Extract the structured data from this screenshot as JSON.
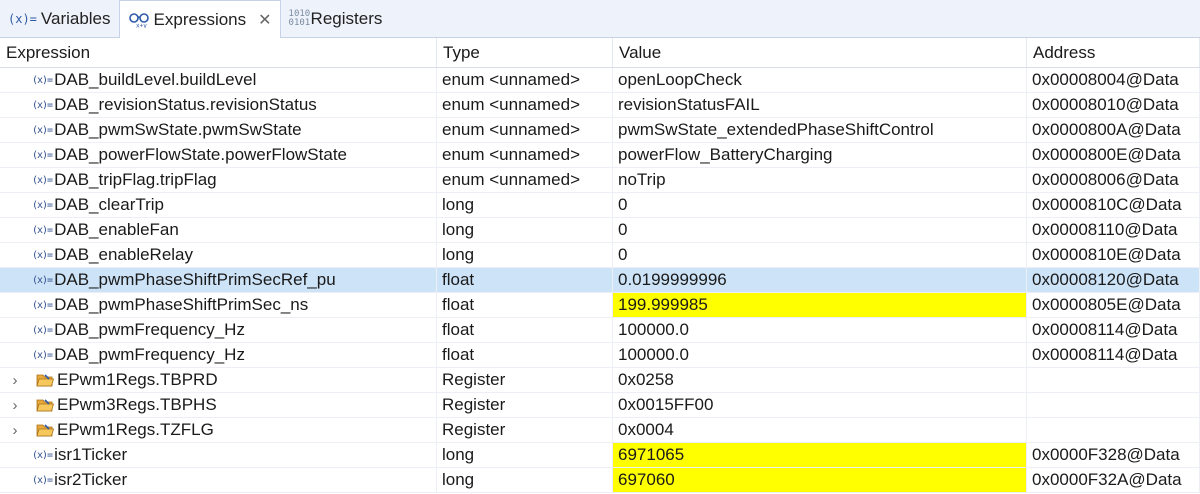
{
  "tabs": [
    {
      "label": "Variables",
      "icon": "variables-icon"
    },
    {
      "label": "Expressions",
      "icon": "expressions-icon",
      "active": true
    },
    {
      "label": "Registers",
      "icon": "registers-icon"
    }
  ],
  "tab_icons": {
    "variables": "(x)=",
    "registers_top": "1010",
    "registers_bottom": "0101",
    "close": "✕"
  },
  "columns": [
    "Expression",
    "Type",
    "Value",
    "Address"
  ],
  "rows": [
    {
      "expr": "DAB_buildLevel.buildLevel",
      "type": "enum <unnamed>",
      "value": "openLoopCheck",
      "addr": "0x00008004@Data"
    },
    {
      "expr": "DAB_revisionStatus.revisionStatus",
      "type": "enum <unnamed>",
      "value": "revisionStatusFAIL",
      "addr": "0x00008010@Data"
    },
    {
      "expr": "DAB_pwmSwState.pwmSwState",
      "type": "enum <unnamed>",
      "value": "pwmSwState_extendedPhaseShiftControl",
      "addr": "0x0000800A@Data"
    },
    {
      "expr": "DAB_powerFlowState.powerFlowState",
      "type": "enum <unnamed>",
      "value": "powerFlow_BatteryCharging",
      "addr": "0x0000800E@Data"
    },
    {
      "expr": "DAB_tripFlag.tripFlag",
      "type": "enum <unnamed>",
      "value": "noTrip",
      "addr": "0x00008006@Data"
    },
    {
      "expr": "DAB_clearTrip",
      "type": "long",
      "value": "0",
      "addr": "0x0000810C@Data"
    },
    {
      "expr": "DAB_enableFan",
      "type": "long",
      "value": "0",
      "addr": "0x00008110@Data"
    },
    {
      "expr": "DAB_enableRelay",
      "type": "long",
      "value": "0",
      "addr": "0x0000810E@Data"
    },
    {
      "expr": "DAB_pwmPhaseShiftPrimSecRef_pu",
      "type": "float",
      "value": "0.0199999996",
      "addr": "0x00008120@Data",
      "selected": true
    },
    {
      "expr": "DAB_pwmPhaseShiftPrimSec_ns",
      "type": "float",
      "value": "199.999985",
      "addr": "0x0000805E@Data",
      "highlight": true
    },
    {
      "expr": "DAB_pwmFrequency_Hz",
      "type": "float",
      "value": "100000.0",
      "addr": "0x00008114@Data"
    },
    {
      "expr": "DAB_pwmFrequency_Hz",
      "type": "float",
      "value": "100000.0",
      "addr": "0x00008114@Data"
    },
    {
      "expr": "EPwm1Regs.TBPRD",
      "type": "Register",
      "value": "0x0258",
      "addr": "",
      "register": true
    },
    {
      "expr": "EPwm3Regs.TBPHS",
      "type": "Register",
      "value": "0x0015FF00",
      "addr": "",
      "register": true
    },
    {
      "expr": "EPwm1Regs.TZFLG",
      "type": "Register",
      "value": "0x0004",
      "addr": "",
      "register": true
    },
    {
      "expr": "isr1Ticker",
      "type": "long",
      "value": "6971065",
      "addr": "0x0000F328@Data",
      "highlight": true
    },
    {
      "expr": "isr2Ticker",
      "type": "long",
      "value": "697060",
      "addr": "0x0000F32A@Data",
      "highlight": true
    }
  ],
  "row_icon": "(x)=",
  "expander_glyph": "›",
  "colors": {
    "selected_row": "#cde3f7",
    "changed_value": "#ffff00",
    "tabbar": "#eef2fa"
  }
}
